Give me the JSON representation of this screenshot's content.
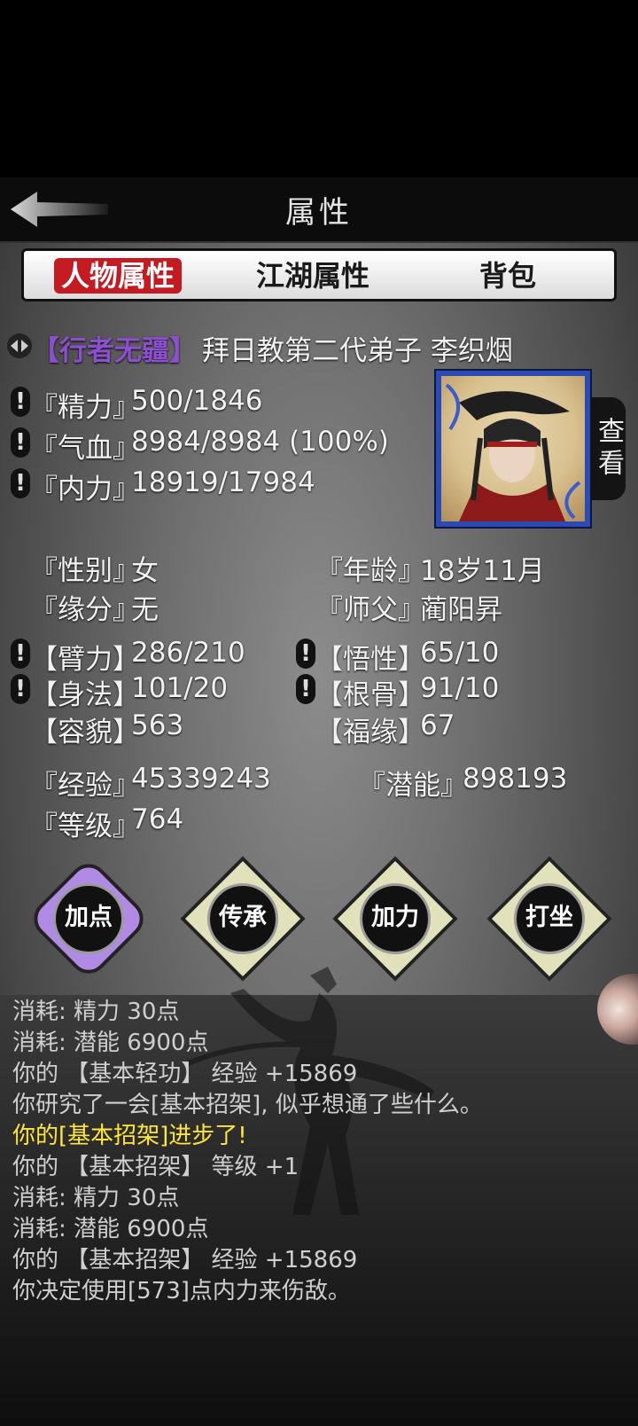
{
  "header": {
    "title": "属性"
  },
  "tabs": [
    {
      "label": "人物属性",
      "active": true
    },
    {
      "label": "江湖属性",
      "active": false
    },
    {
      "label": "背包",
      "active": false
    }
  ],
  "profile": {
    "badge": "【行者无疆】",
    "title_name": "拜日教第二代弟子 李织烟",
    "view_button": "查看"
  },
  "vitals": [
    {
      "label": "『精力』",
      "value": "500/1846"
    },
    {
      "label": "『气血』",
      "value": "8984/8984 (100%)"
    },
    {
      "label": "『内力』",
      "value": "18919/17984"
    }
  ],
  "info": {
    "gender_label": "『性别』",
    "gender": "女",
    "age_label": "『年龄』",
    "age": "18岁11月",
    "fate_label": "『缘分』",
    "fate": "无",
    "master_label": "『师父』",
    "master": "蔺阳昇"
  },
  "attributes": {
    "strength_label": "【臂力】",
    "strength": "286/210",
    "wisdom_label": "【悟性】",
    "wisdom": "65/10",
    "agility_label": "【身法】",
    "agility": "101/20",
    "constitution_label": "【根骨】",
    "constitution": "91/10",
    "looks_label": "【容貌】",
    "looks": "563",
    "luck_label": "【福缘】",
    "luck": "67"
  },
  "progress": {
    "exp_label": "『经验』",
    "exp": "45339243",
    "potential_label": "『潜能』",
    "potential": "898193",
    "level_label": "『等级』",
    "level": "764"
  },
  "actions": [
    {
      "label": "加点",
      "active": true
    },
    {
      "label": "传承",
      "active": false
    },
    {
      "label": "加力",
      "active": false
    },
    {
      "label": "打坐",
      "active": false
    }
  ],
  "log": [
    {
      "text": "消耗: 精力 30点",
      "highlight": false
    },
    {
      "text": "消耗: 潜能 6900点",
      "highlight": false
    },
    {
      "text": "你的 【基本轻功】 经验 +15869",
      "highlight": false
    },
    {
      "text": "你研究了一会[基本招架], 似乎想通了些什么。",
      "highlight": false
    },
    {
      "text": "你的[基本招架]进步了!",
      "highlight": true
    },
    {
      "text": "你的 【基本招架】 等级 +1",
      "highlight": false
    },
    {
      "text": "消耗: 精力 30点",
      "highlight": false
    },
    {
      "text": "消耗: 潜能 6900点",
      "highlight": false
    },
    {
      "text": "你的 【基本招架】 经验 +15869",
      "highlight": false
    },
    {
      "text": "你决定使用[573]点内力来伤敌。",
      "highlight": false
    }
  ],
  "colors": {
    "active_tab": "#c41b23",
    "badge": "#8b4fd0",
    "log_highlight": "#ffe63a",
    "portrait_frame": "#2b4ab3"
  }
}
